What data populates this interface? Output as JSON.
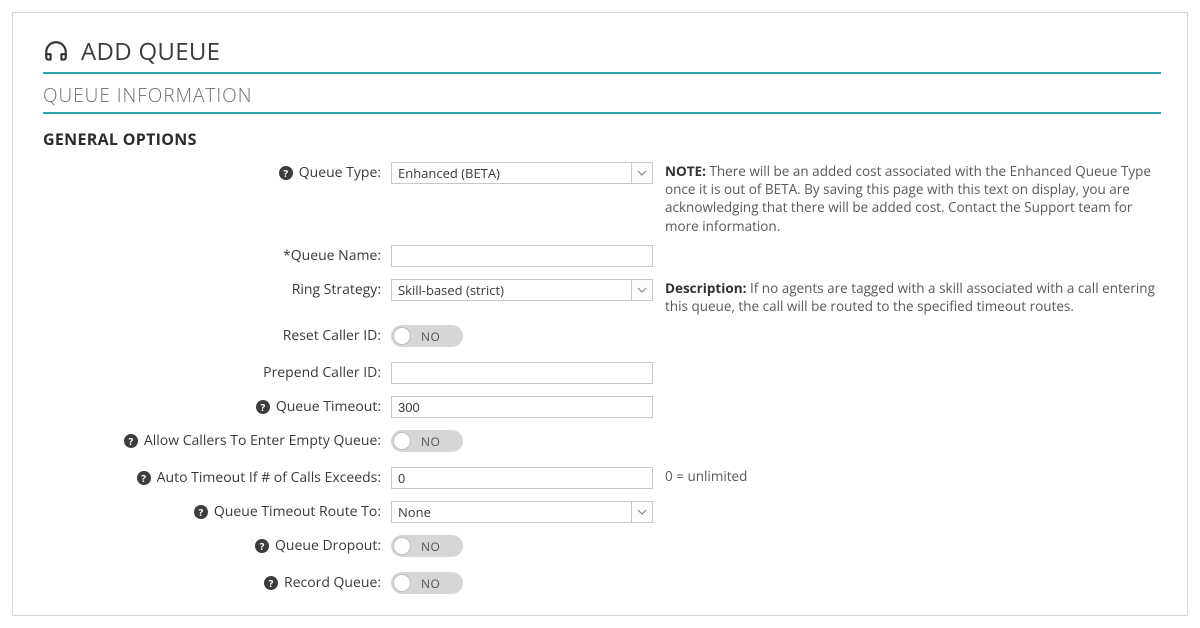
{
  "page": {
    "title": "ADD QUEUE",
    "section": "QUEUE INFORMATION",
    "subsection": "GENERAL OPTIONS"
  },
  "labels": {
    "queue_type": "Queue Type:",
    "queue_name": "*Queue Name:",
    "ring_strategy": "Ring Strategy:",
    "reset_caller_id": "Reset Caller ID:",
    "prepend_caller_id": "Prepend Caller ID:",
    "queue_timeout": "Queue Timeout:",
    "allow_empty": "Allow Callers To Enter Empty Queue:",
    "auto_timeout": "Auto Timeout If # of Calls Exceeds:",
    "timeout_route": "Queue Timeout Route To:",
    "queue_dropout": "Queue Dropout:",
    "record_queue": "Record Queue:"
  },
  "values": {
    "queue_type": "Enhanced (BETA)",
    "queue_name": "",
    "ring_strategy": "Skill-based (strict)",
    "reset_caller_id": "NO",
    "prepend_caller_id": "",
    "queue_timeout": "300",
    "allow_empty": "NO",
    "auto_timeout": "0",
    "timeout_route": "None",
    "queue_dropout": "NO",
    "record_queue": "NO"
  },
  "side": {
    "note_prefix": "NOTE:",
    "note_text": " There will be an added cost associated with the Enhanced Queue Type once it is out of BETA. By saving this page with this text on display, you are acknowledging that there will be added cost. Contact the Support team for more information.",
    "desc_prefix": "Description:",
    "desc_text": " If no agents are tagged with a skill associated with a call entering this queue, the call will be routed to the specified timeout routes.",
    "auto_timeout_hint": "0 = unlimited"
  },
  "help_glyph": "?"
}
